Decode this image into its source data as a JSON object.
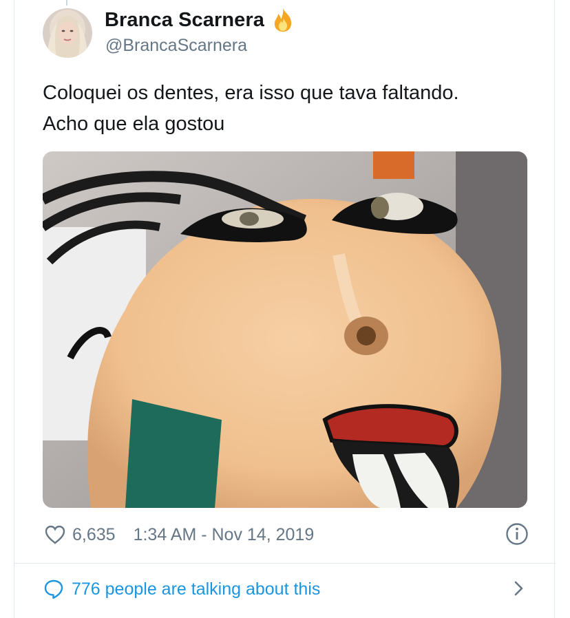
{
  "tweet": {
    "display_name": "Branca Scarnera",
    "handle": "@BrancaScarnera",
    "text_lines": [
      "Coloquei os dentes, era isso que tava faltando.",
      "Acho que ela gostou"
    ],
    "likes": "6,635",
    "timestamp": "1:34 AM - Nov 14, 2019",
    "conversation_link": "776 people are talking about this"
  },
  "icons": {
    "name_emoji": "fire-emoji",
    "like": "heart-icon",
    "info": "info-icon",
    "conversation": "speech-bubble-icon",
    "chevron": "chevron-right-icon"
  },
  "colors": {
    "link_blue": "#1b95e0",
    "secondary_text": "#657786",
    "primary_text": "#14171a",
    "border": "#e1e8ed"
  }
}
